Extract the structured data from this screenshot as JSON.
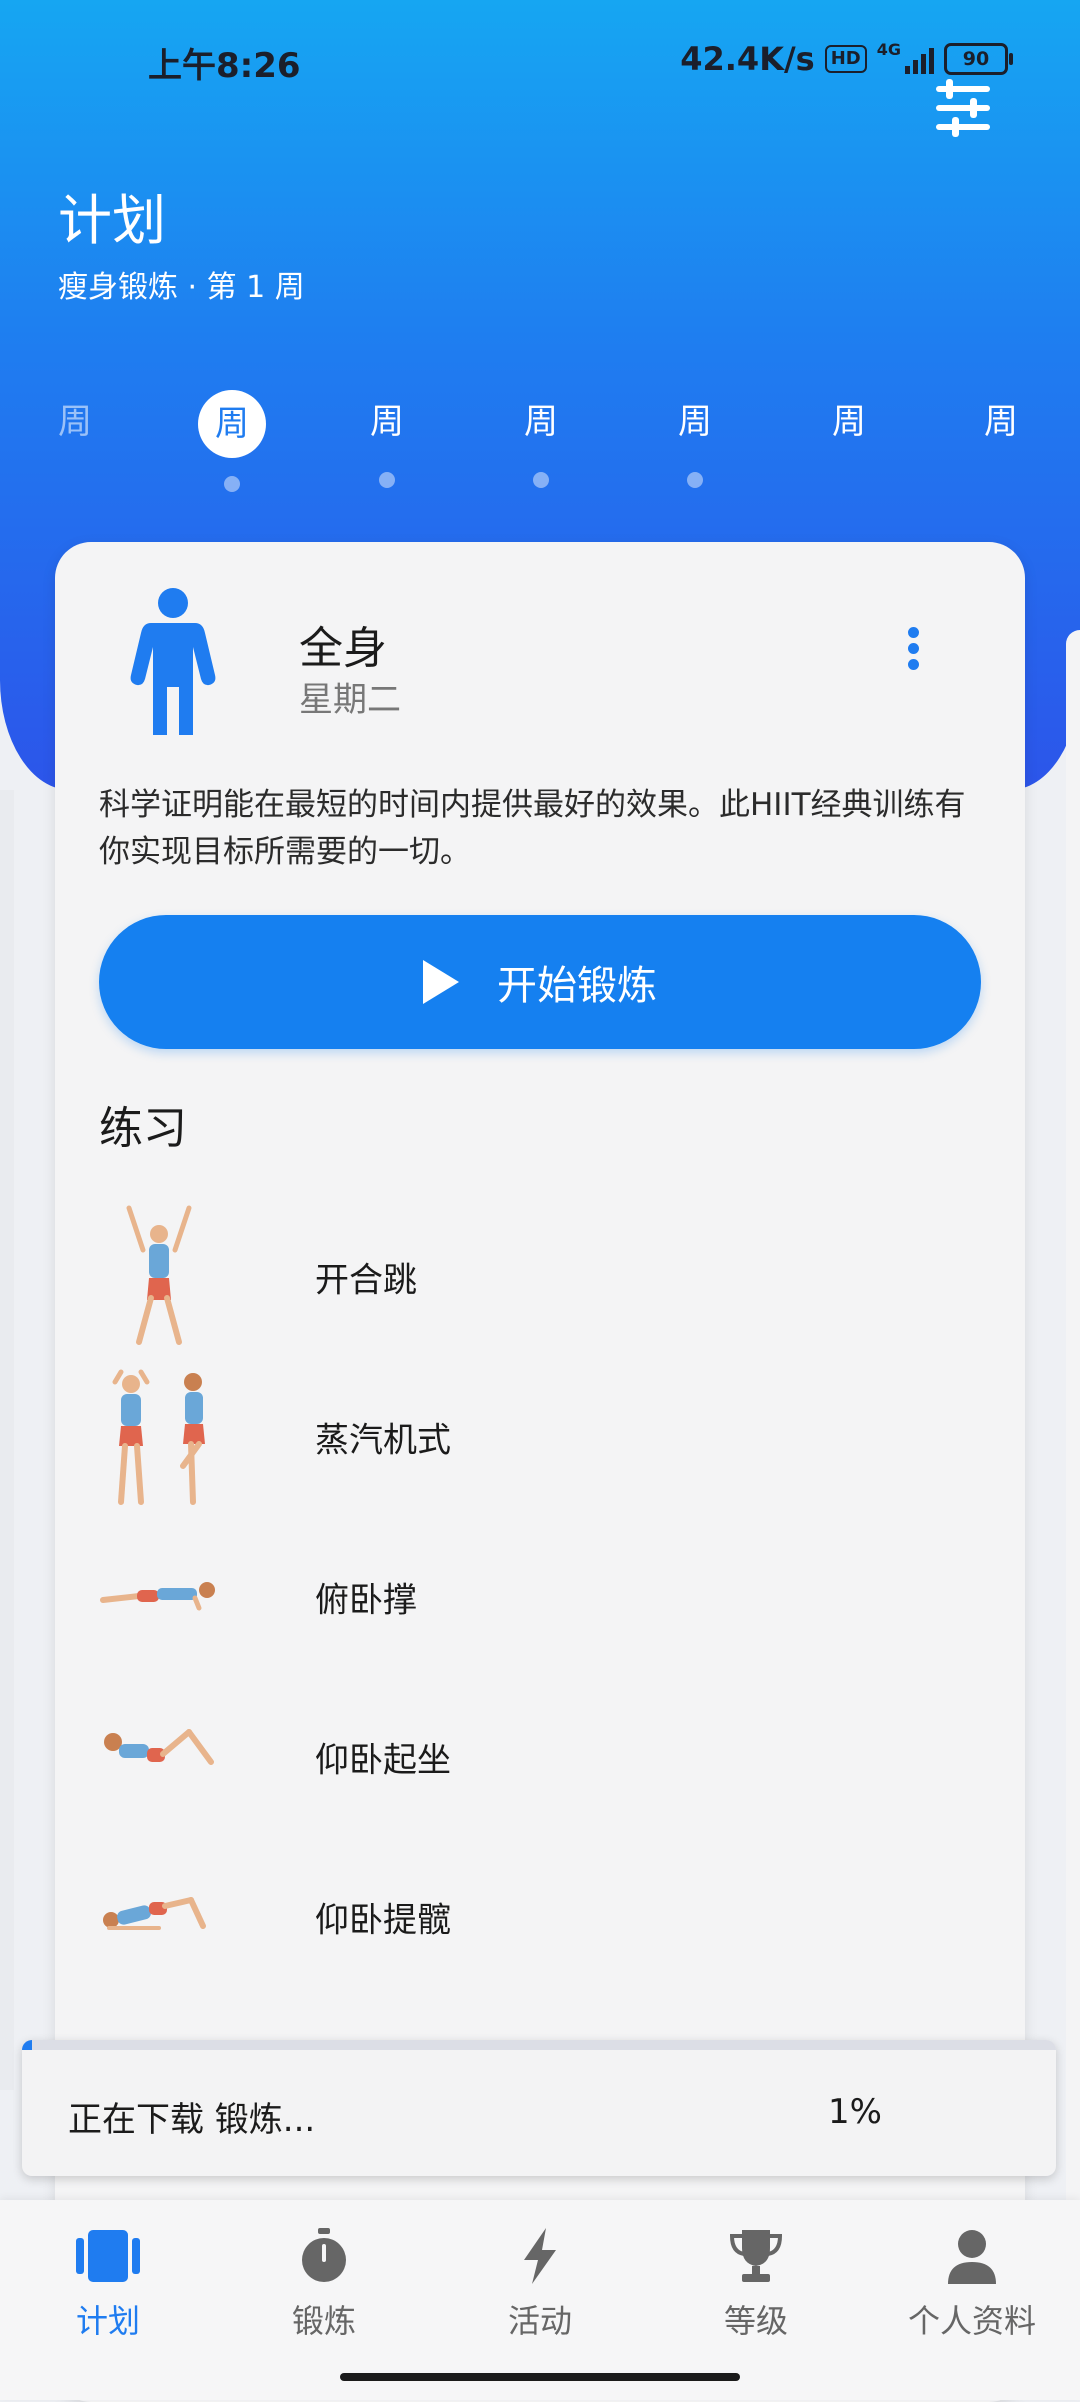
{
  "status_bar": {
    "time": "上午8:26",
    "speed": "42.4K/s",
    "hd": "HD",
    "network": "4G",
    "battery": "90"
  },
  "header": {
    "title": "计划",
    "subtitle": "瘦身锻炼 · 第 1 周"
  },
  "week_days": [
    {
      "label": "周",
      "state": "past"
    },
    {
      "label": "周",
      "state": "selected"
    },
    {
      "label": "周",
      "state": "upcoming"
    },
    {
      "label": "周",
      "state": "upcoming"
    },
    {
      "label": "周",
      "state": "upcoming"
    },
    {
      "label": "周",
      "state": "upcoming"
    },
    {
      "label": "周",
      "state": "upcoming"
    }
  ],
  "workout": {
    "title": "全身",
    "day": "星期二",
    "description": "科学证明能在最短的时间内提供最好的效果。此HIIT经典训练有你实现目标所需要的一切。",
    "start_label": "开始锻炼"
  },
  "exercises": {
    "heading": "练习",
    "items": [
      {
        "name": "开合跳",
        "icon": "jumping-jack-figure"
      },
      {
        "name": "蒸汽机式",
        "icon": "steam-engine-figure"
      },
      {
        "name": "俯卧撑",
        "icon": "push-up-figure"
      },
      {
        "name": "仰卧起坐",
        "icon": "sit-up-figure"
      },
      {
        "name": "仰卧提髋",
        "icon": "hip-raise-figure"
      }
    ]
  },
  "download_toast": {
    "message": "正在下载 锻炼...",
    "percent_label": "1%",
    "progress": 0.01
  },
  "bottom_nav": [
    {
      "label": "计划",
      "icon": "plan-icon",
      "active": true
    },
    {
      "label": "锻炼",
      "icon": "stopwatch-icon",
      "active": false
    },
    {
      "label": "活动",
      "icon": "lightning-icon",
      "active": false
    },
    {
      "label": "等级",
      "icon": "trophy-icon",
      "active": false
    },
    {
      "label": "个人资料",
      "icon": "person-icon",
      "active": false
    }
  ],
  "colors": {
    "accent": "#1f7cf0",
    "hero_top": "#16a6f2",
    "hero_bottom": "#2c55ea"
  }
}
